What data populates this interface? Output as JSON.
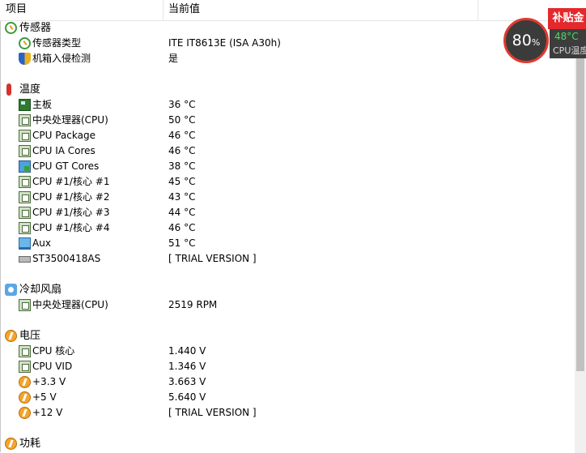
{
  "header": {
    "col_item": "项目",
    "col_value": "当前值"
  },
  "sections": {
    "sensor": {
      "title": "传感器",
      "type_label": "传感器类型",
      "type_value": "ITE IT8613E  (ISA A30h)",
      "intrusion_label": "机箱入侵检测",
      "intrusion_value": "是"
    },
    "temperature": {
      "title": "温度",
      "items": [
        {
          "label": "主板",
          "value": "36 °C"
        },
        {
          "label": "中央处理器(CPU)",
          "value": "50 °C"
        },
        {
          "label": "CPU Package",
          "value": "46 °C"
        },
        {
          "label": "CPU IA Cores",
          "value": "46 °C"
        },
        {
          "label": "CPU GT Cores",
          "value": "38 °C"
        },
        {
          "label": "CPU #1/核心 #1",
          "value": "45 °C"
        },
        {
          "label": "CPU #1/核心 #2",
          "value": "43 °C"
        },
        {
          "label": "CPU #1/核心 #3",
          "value": "44 °C"
        },
        {
          "label": "CPU #1/核心 #4",
          "value": "46 °C"
        },
        {
          "label": "Aux",
          "value": "51 °C"
        },
        {
          "label": "ST3500418AS",
          "value": "[ TRIAL VERSION ]"
        }
      ]
    },
    "fans": {
      "title": "冷却风扇",
      "items": [
        {
          "label": "中央处理器(CPU)",
          "value": "2519 RPM"
        }
      ]
    },
    "voltage": {
      "title": "电压",
      "items": [
        {
          "label": "CPU 核心",
          "value": "1.440 V"
        },
        {
          "label": "CPU VID",
          "value": "1.346 V"
        },
        {
          "label": "+3.3 V",
          "value": "3.663 V"
        },
        {
          "label": "+5 V",
          "value": "5.640 V"
        },
        {
          "label": "+12 V",
          "value": "[ TRIAL VERSION ]"
        }
      ]
    },
    "power": {
      "title": "功耗"
    }
  },
  "widget": {
    "gauge_value": "80",
    "gauge_unit": "%",
    "subsidy_label": "补贴金",
    "cpu_temp": "48°C",
    "cpu_temp_label": "CPU温度"
  },
  "scroll": {
    "visible_fraction": 0.81
  }
}
